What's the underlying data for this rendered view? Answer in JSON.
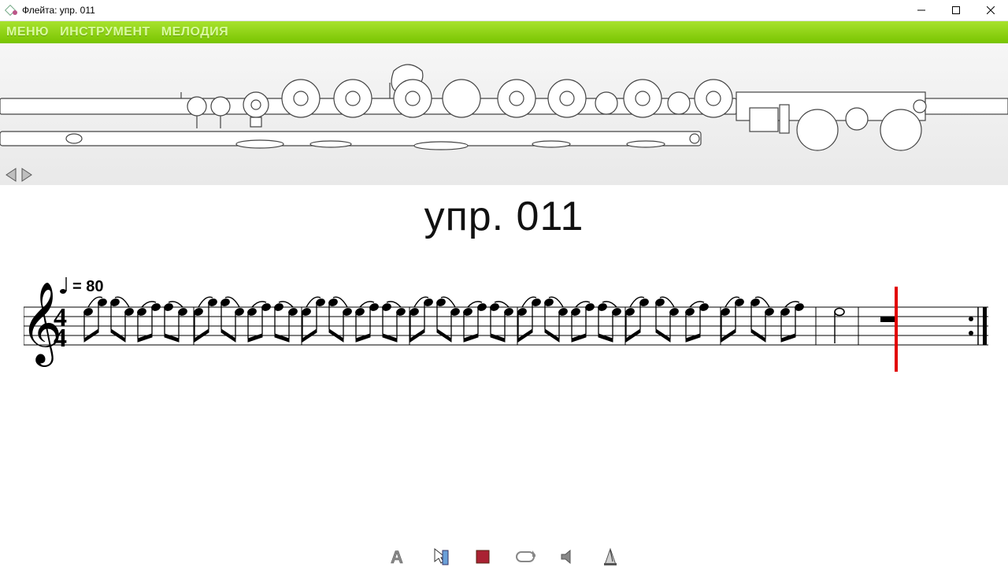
{
  "window": {
    "title": "Флейта: упр. 011"
  },
  "menubar": {
    "items": [
      "МЕНЮ",
      "ИНСТРУМЕНТ",
      "МЕЛОДИЯ"
    ]
  },
  "score": {
    "heading": "упр. 011",
    "tempo_label": "= 80",
    "time_signature": {
      "top": "4",
      "bottom": "4"
    }
  },
  "toolbar": {
    "icons": [
      "A-button",
      "cursor",
      "stop",
      "loop",
      "sound",
      "metronome"
    ]
  }
}
